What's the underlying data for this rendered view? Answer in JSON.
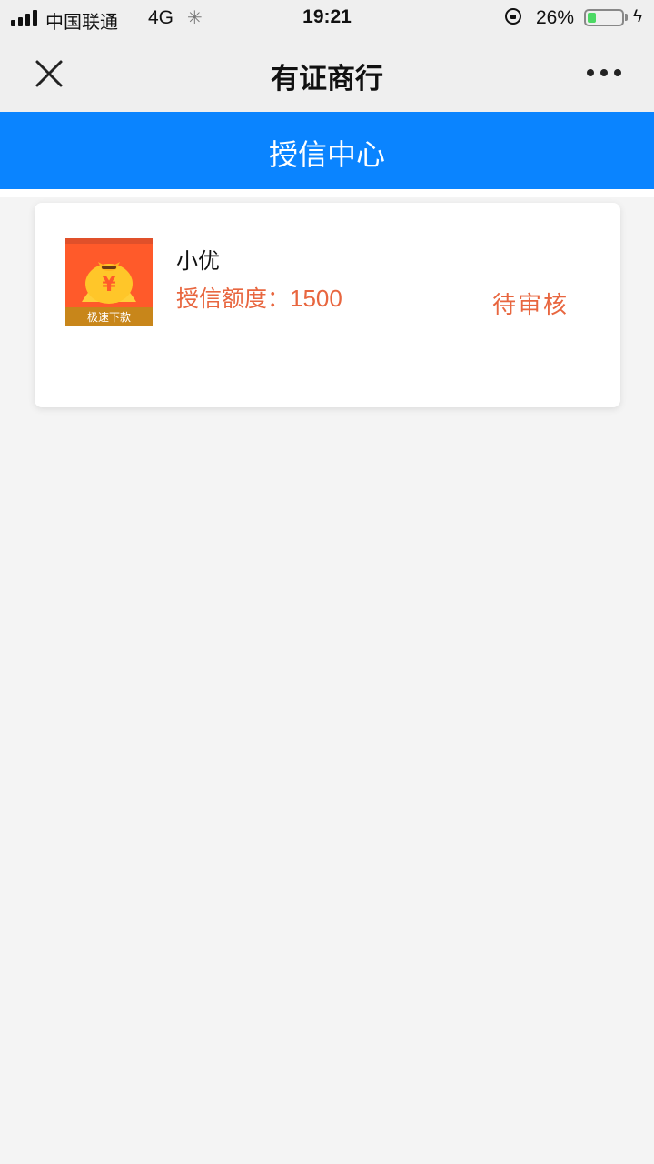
{
  "status_bar": {
    "carrier": "中国联通",
    "network": "4G",
    "time": "19:21",
    "battery_percent": "26%",
    "battery_level": 0.26,
    "battery_color": "#4cd964"
  },
  "nav": {
    "title": "有证商行",
    "close_icon": "close-icon",
    "more_icon": "more-dots-icon"
  },
  "header": {
    "title": "授信中心",
    "background": "#0a84ff"
  },
  "card": {
    "app_name": "小优",
    "credit_label": "授信额度：",
    "credit_value": "1500",
    "status": "待审核",
    "icon_badge_text": "极速下款",
    "accent_color": "#e8663f"
  }
}
